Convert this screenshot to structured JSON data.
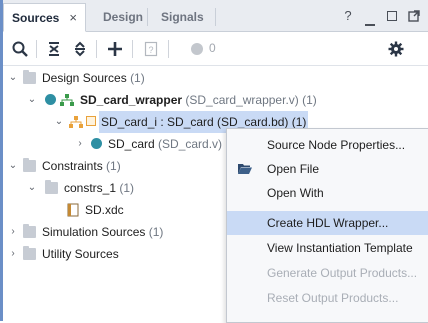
{
  "tabs": [
    {
      "label": "Sources",
      "active": true,
      "close": "×"
    },
    {
      "label": "Design",
      "active": false
    },
    {
      "label": "Signals",
      "active": false
    }
  ],
  "window_controls": {
    "help": "?",
    "minimize": "–",
    "restore": "□",
    "popout": "⧉"
  },
  "toolbar": {
    "search_icon": "search-icon",
    "collapse_all_icon": "collapse-all-icon",
    "expand_all_icon": "expand-all-icon",
    "add_icon": "add-icon",
    "properties_icon": "question-file-icon",
    "count": "0"
  },
  "tree": {
    "design_sources": {
      "label": "Design Sources",
      "count": "(1)"
    },
    "wrapper": {
      "name": "SD_card_wrapper",
      "file": "(SD_card_wrapper.v) (1)"
    },
    "bd_instance": {
      "label": "SD_card_i : SD_card (SD_card.bd) (1)"
    },
    "sd_card": {
      "name": "SD_card",
      "file": "(SD_card.v)"
    },
    "constraints": {
      "label": "Constraints",
      "count": "(1)"
    },
    "constrs": {
      "label": "constrs_1",
      "count": "(1)"
    },
    "xdc": {
      "label": "SD.xdc"
    },
    "simulation": {
      "label": "Simulation Sources",
      "count": "(1)"
    },
    "utility": {
      "label": "Utility Sources"
    }
  },
  "context_menu": {
    "items": [
      {
        "label": "Source Node Properties...",
        "enabled": true
      },
      {
        "label": "Open File",
        "enabled": true
      },
      {
        "label": "Open With",
        "enabled": true
      },
      {
        "label": "Create HDL Wrapper...",
        "enabled": true,
        "highlighted": true
      },
      {
        "label": "View Instantiation Template",
        "enabled": true
      },
      {
        "label": "Generate Output Products...",
        "enabled": false
      },
      {
        "label": "Reset Output Products...",
        "enabled": false
      }
    ]
  },
  "colors": {
    "accent": "#6b8fc7",
    "selection": "#c9daf5",
    "teal": "#2e8fa3",
    "orange": "#e9a23b"
  }
}
